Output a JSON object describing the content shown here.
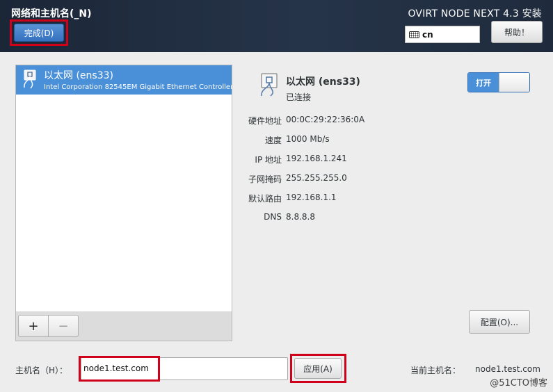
{
  "header": {
    "spoke_title": "网络和主机名(_N)",
    "done_label": "完成(D)",
    "product_title": "OVIRT NODE NEXT 4.3 安装",
    "keyboard_layout": "cn",
    "help_label": "帮助！"
  },
  "device_list": {
    "items": [
      {
        "name": "以太网 (ens33)",
        "description": "Intel Corporation 82545EM Gigabit Ethernet Controller ("
      }
    ],
    "add_label": "+",
    "remove_label": "−"
  },
  "details": {
    "name": "以太网 (ens33)",
    "status": "已连接",
    "toggle_label": "打开",
    "properties": [
      {
        "label": "硬件地址",
        "value": "00:0C:29:22:36:0A"
      },
      {
        "label": "速度",
        "value": "1000 Mb/s"
      },
      {
        "label": "IP 地址",
        "value": "192.168.1.241"
      },
      {
        "label": "子网掩码",
        "value": "255.255.255.0"
      },
      {
        "label": "默认路由",
        "value": "192.168.1.1"
      },
      {
        "label": "DNS",
        "value": "8.8.8.8"
      }
    ],
    "config_label": "配置(O)..."
  },
  "hostname": {
    "label": "主机名（H）：",
    "value": "node1.test.com",
    "apply_label": "应用(A)",
    "current_label": "当前主机名：",
    "current_value": "node1.test.com"
  },
  "watermark": "@51CTO博客",
  "colors": {
    "header_bg": "#1f2b3d",
    "accent": "#4a90d9",
    "highlight": "#d0021b"
  }
}
